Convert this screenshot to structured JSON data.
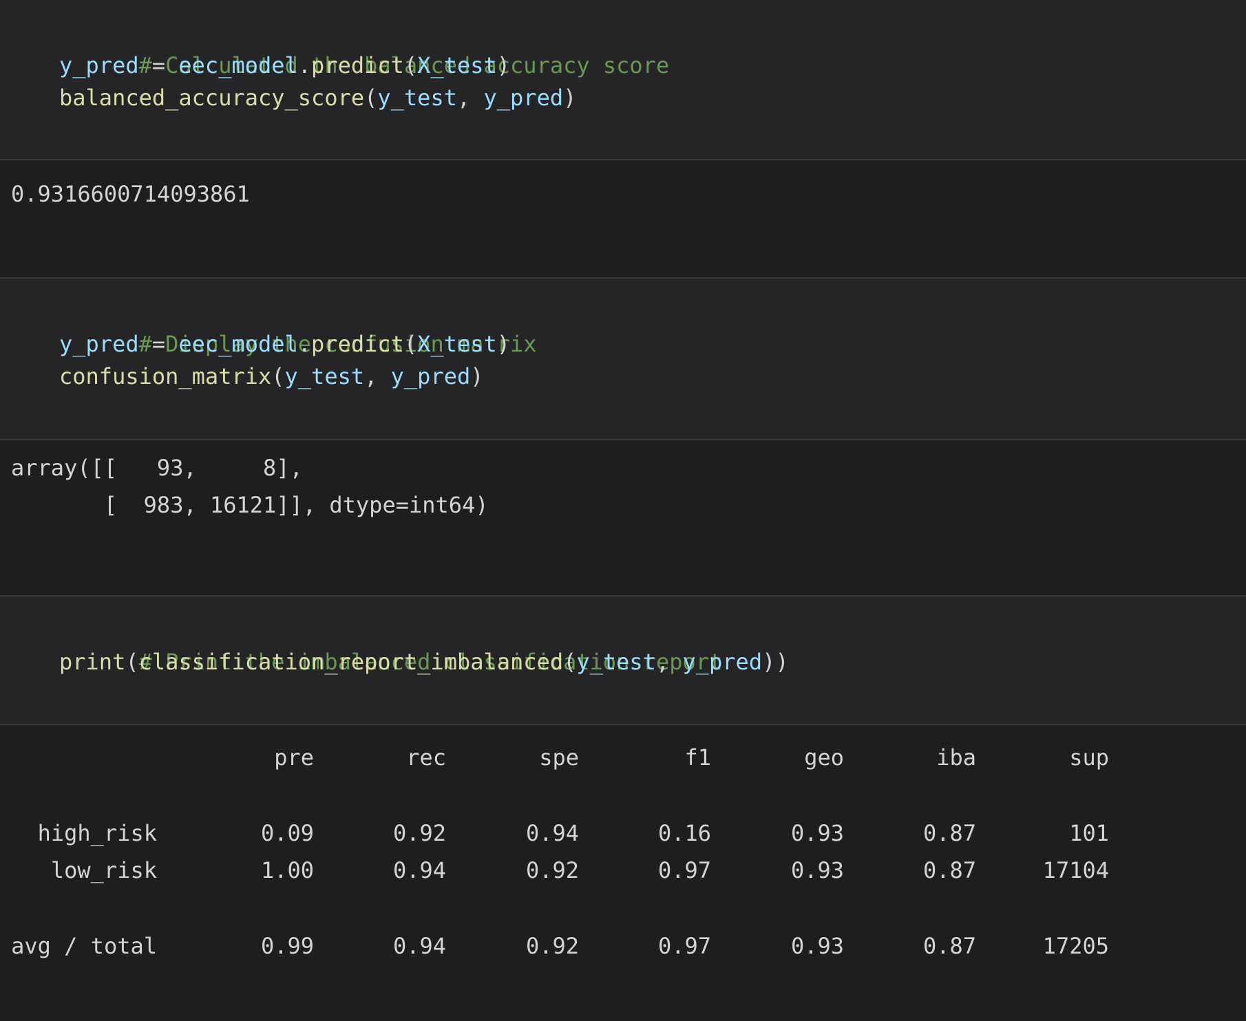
{
  "cells": [
    {
      "comment": "# Calculated the balanced accuracy score",
      "line1": {
        "var": "y_pred",
        "op": " = ",
        "obj": "eec_model",
        "dot": ".",
        "func": "predict",
        "open": "(",
        "arg": "X_test",
        "close": ")"
      },
      "line2": {
        "func": "balanced_accuracy_score",
        "open": "(",
        "arg1": "y_test",
        "sep": ", ",
        "arg2": "y_pred",
        "close": ")"
      },
      "output": "0.9316600714093861"
    },
    {
      "comment": "# Display the confusion matrix",
      "line1": {
        "var": "y_pred",
        "op": " = ",
        "obj": "eec_model",
        "dot": ".",
        "func": "predict",
        "open": "(",
        "arg": "X_test",
        "close": ")"
      },
      "line2": {
        "func": "confusion_matrix",
        "open": "(",
        "arg1": "y_test",
        "sep": ", ",
        "arg2": "y_pred",
        "close": ")"
      },
      "output_lines": [
        "array([[   93,     8],",
        "       [  983, 16121]], dtype=int64)"
      ]
    },
    {
      "comment": "# Print the imbalanced classification report",
      "line1": {
        "func": "print",
        "open": "(",
        "inner_func": "classification_report_imbalanced",
        "open2": "(",
        "arg1": "y_test",
        "sep": ", ",
        "arg2": "y_pred",
        "close": "))"
      }
    }
  ],
  "report": {
    "headers": [
      "pre",
      "rec",
      "spe",
      "f1",
      "geo",
      "iba",
      "sup"
    ],
    "rows": [
      {
        "label": "high_risk",
        "values": [
          "0.09",
          "0.92",
          "0.94",
          "0.16",
          "0.93",
          "0.87",
          "101"
        ]
      },
      {
        "label": "low_risk",
        "values": [
          "1.00",
          "0.94",
          "0.92",
          "0.97",
          "0.93",
          "0.87",
          "17104"
        ]
      }
    ],
    "total": {
      "label": "avg / total",
      "values": [
        "0.99",
        "0.94",
        "0.92",
        "0.97",
        "0.93",
        "0.87",
        "17205"
      ]
    }
  }
}
